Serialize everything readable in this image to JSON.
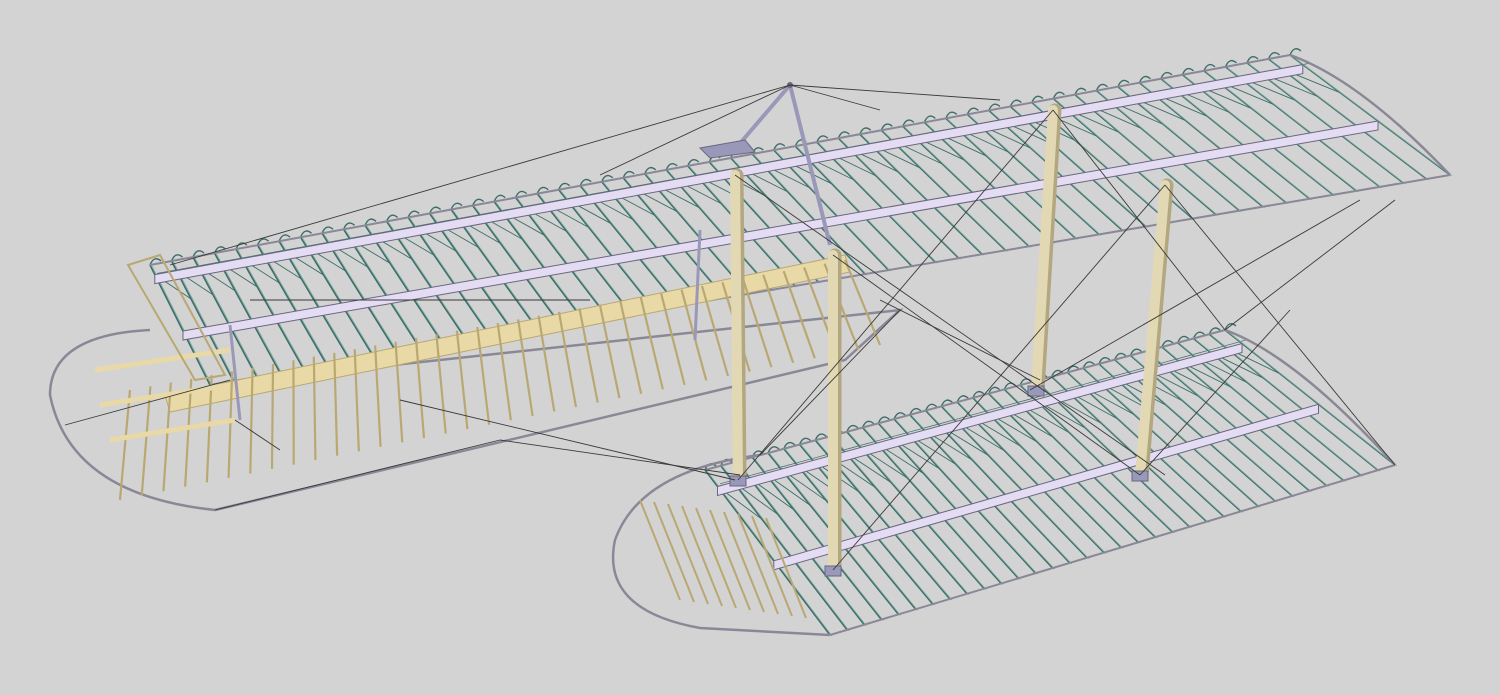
{
  "viewport": {
    "background": "#d3d3d3"
  },
  "model": {
    "components": [
      "upper-wing",
      "lower-wing",
      "aileron",
      "interplane-struts",
      "cabane-strut",
      "bracing-wires",
      "ribs",
      "spars"
    ]
  },
  "colors": {
    "rib_framework": "#3c6e68",
    "rib_light": "#7aa8a0",
    "spar_face": "#e4dcf2",
    "spar_outline": "#6a6680",
    "wingtip_outline": "#8a8896",
    "aileron_wood": "#e8d9a6",
    "aileron_wood_dark": "#b9a872",
    "strut": "#e3d8b4",
    "strut_shadow": "#b3a77f",
    "bracing_wire": "#3a3a3a",
    "fitting": "#9a98b8"
  }
}
